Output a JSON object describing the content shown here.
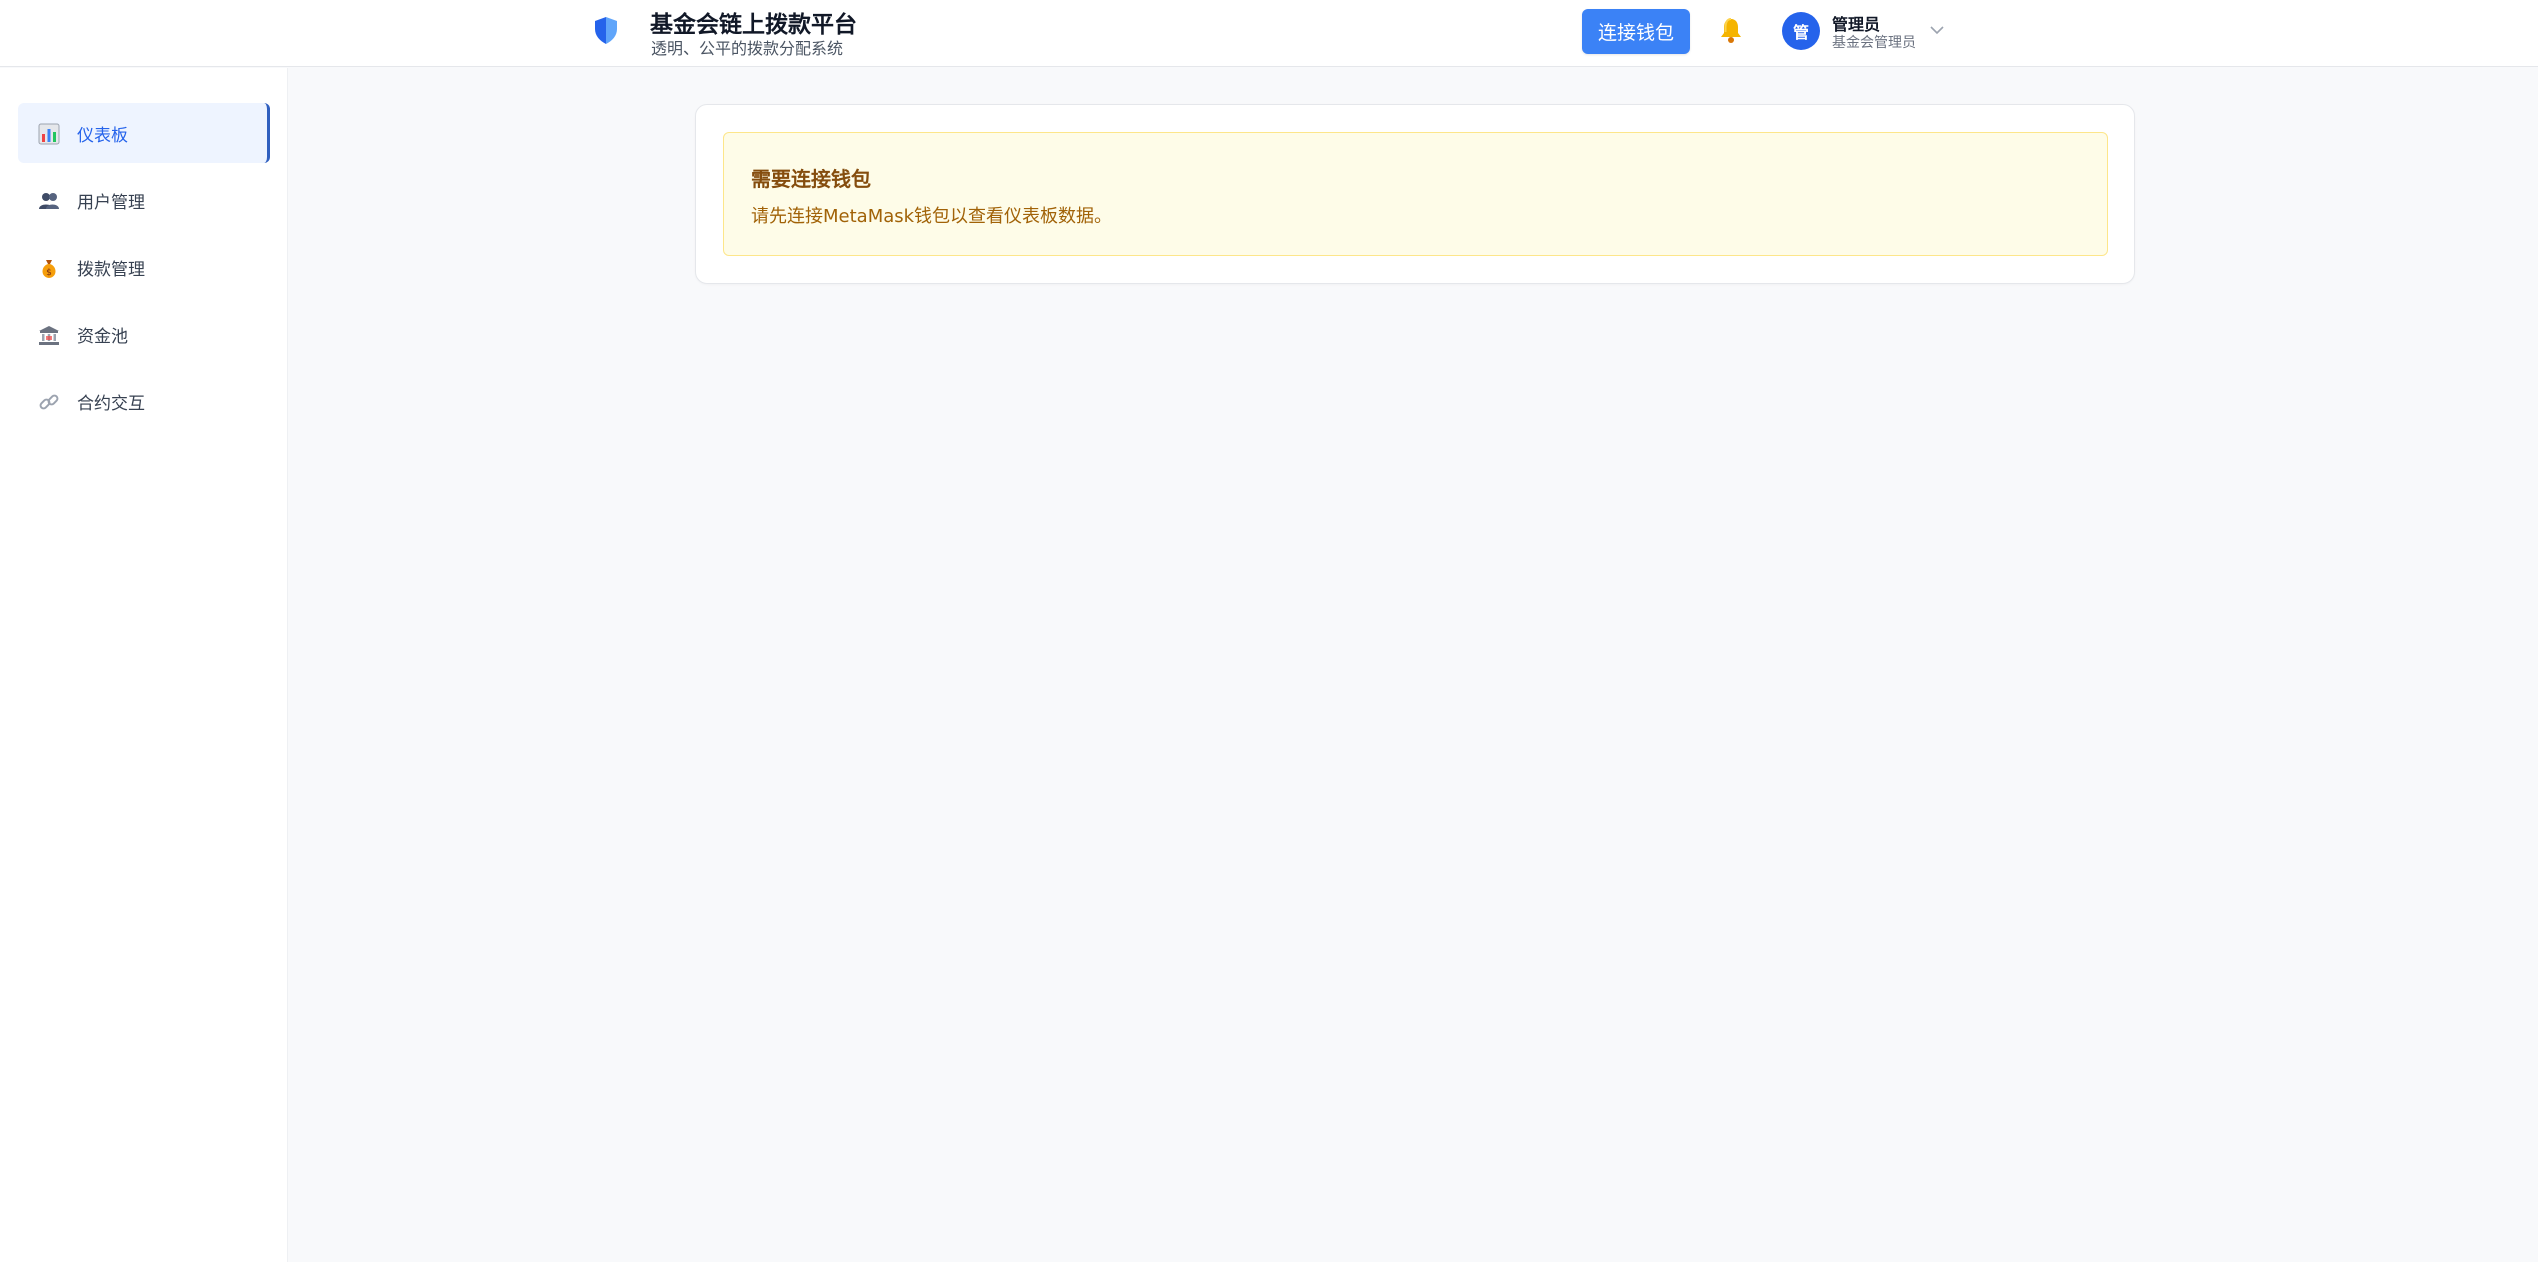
{
  "header": {
    "title": "基金会链上拨款平台",
    "subtitle": "透明、公平的拨款分配系统",
    "connect_button": "连接钱包",
    "logo_icon": "shield-icon",
    "bell_icon": "bell-icon",
    "user": {
      "avatar_text": "管",
      "name": "管理员",
      "role": "基金会管理员"
    }
  },
  "sidebar": {
    "items": [
      {
        "label": "仪表板",
        "icon": "bar-chart-icon",
        "active": true
      },
      {
        "label": "用户管理",
        "icon": "users-icon",
        "active": false
      },
      {
        "label": "拨款管理",
        "icon": "money-bag-icon",
        "active": false
      },
      {
        "label": "资金池",
        "icon": "bank-icon",
        "active": false
      },
      {
        "label": "合约交互",
        "icon": "link-icon",
        "active": false
      }
    ]
  },
  "main": {
    "alert": {
      "title": "需要连接钱包",
      "message": "请先连接MetaMask钱包以查看仪表板数据。"
    }
  },
  "colors": {
    "primary": "#3b82f6",
    "avatar": "#2563eb",
    "alert_bg": "#fefce8",
    "alert_title": "#854d0e",
    "alert_text": "#a16207"
  }
}
